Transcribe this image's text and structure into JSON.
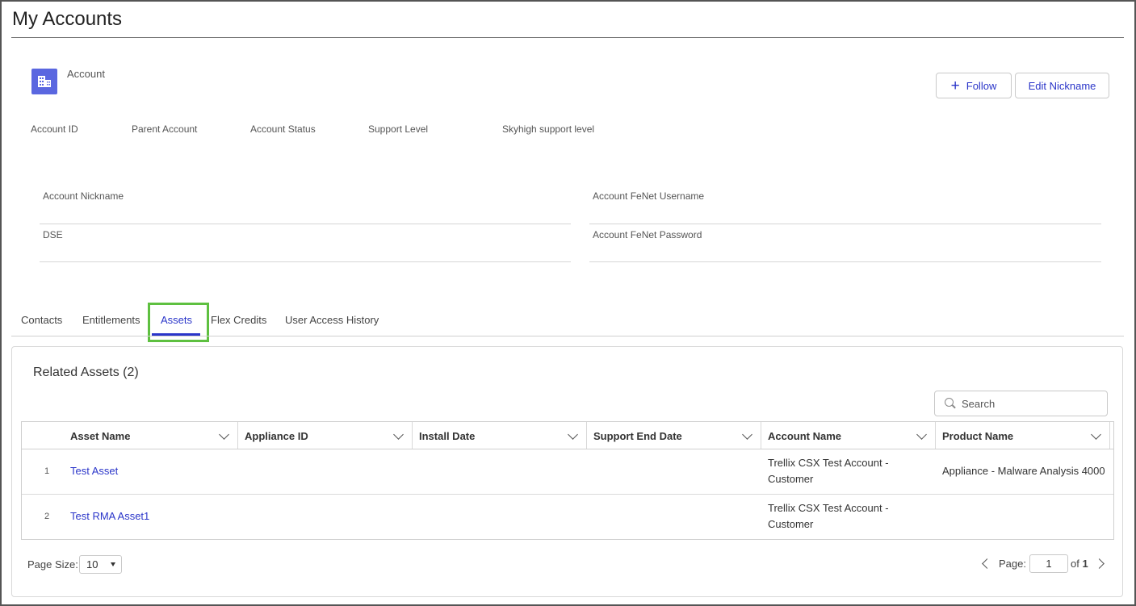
{
  "page": {
    "title": "My Accounts"
  },
  "account": {
    "type_label": "Account",
    "actions": {
      "follow_label": "Follow",
      "edit_nickname_label": "Edit Nickname"
    },
    "header_fields": [
      "Account ID",
      "Parent Account",
      "Account Status",
      "Support Level",
      "Skyhigh support level"
    ],
    "form": {
      "nickname_label": "Account Nickname",
      "fenet_username_label": "Account FeNet Username",
      "dse_label": "DSE",
      "fenet_password_label": "Account FeNet Password"
    }
  },
  "tabs": [
    {
      "label": "Contacts",
      "active": false
    },
    {
      "label": "Entitlements",
      "active": false
    },
    {
      "label": "Assets",
      "active": true
    },
    {
      "label": "Flex Credits",
      "active": false
    },
    {
      "label": "User Access History",
      "active": false
    }
  ],
  "related_assets": {
    "title": "Related Assets (2)",
    "search_placeholder": "Search",
    "columns": [
      "Asset Name",
      "Appliance ID",
      "Install Date",
      "Support End Date",
      "Account Name",
      "Product Name"
    ],
    "rows": [
      {
        "num": "1",
        "asset_name": "Test Asset",
        "appliance_id": "",
        "install_date": "",
        "support_end_date": "",
        "account_name_1": "Trellix CSX Test Account -",
        "account_name_2": "Customer",
        "product_name": "Appliance - Malware Analysis 4000"
      },
      {
        "num": "2",
        "asset_name": "Test RMA Asset1",
        "appliance_id": "",
        "install_date": "",
        "support_end_date": "",
        "account_name_1": "Trellix CSX Test Account -",
        "account_name_2": "Customer",
        "product_name": ""
      }
    ],
    "pagination": {
      "page_size_label": "Page Size:",
      "page_size_value": "10",
      "page_label": "Page:",
      "current_page": "1",
      "of_label": "of",
      "total_pages": "1"
    }
  },
  "colors": {
    "accent": "#2a35c9",
    "icon_bg": "#5a67e0",
    "highlight": "#5ec040"
  }
}
